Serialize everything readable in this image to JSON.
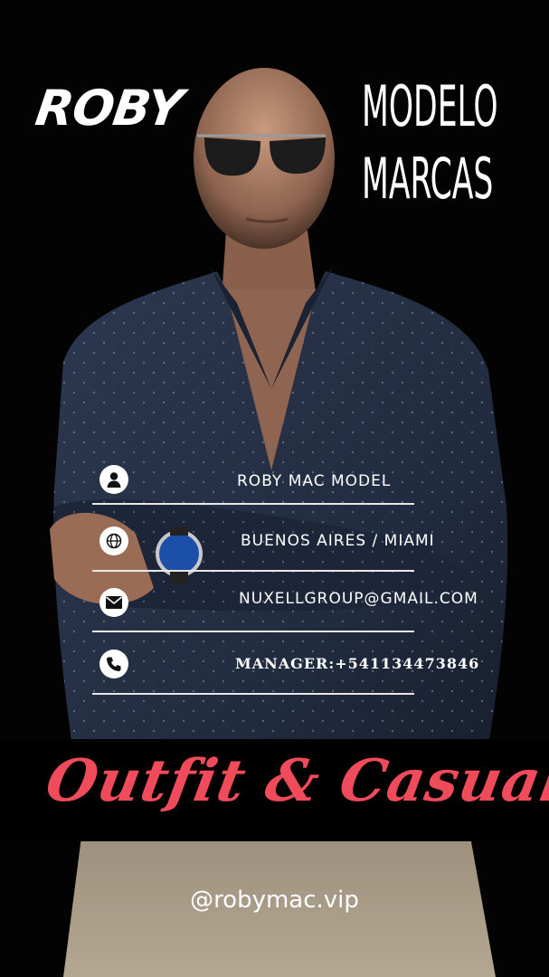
{
  "brand": {
    "name": "ROBY"
  },
  "tagline": {
    "line1": "MODELO",
    "line2": "MARCAS"
  },
  "contacts": [
    {
      "icon": "user-icon",
      "text": "ROBY MAC MODEL"
    },
    {
      "icon": "globe-icon",
      "text": "BUENOS AIRES / MIAMI"
    },
    {
      "icon": "mail-icon",
      "text": "NUXELLGROUP@GMAIL.COM"
    },
    {
      "icon": "phone-icon",
      "text": "MANAGER:+541134473846"
    }
  ],
  "headline": "Outfit & Casual",
  "social": {
    "handle": "@robymac.vip"
  },
  "colors": {
    "background": "#000000",
    "accent": "#ef4b5a",
    "text": "#ffffff",
    "shirt": "#26324a",
    "trousers": "#a69a86"
  }
}
